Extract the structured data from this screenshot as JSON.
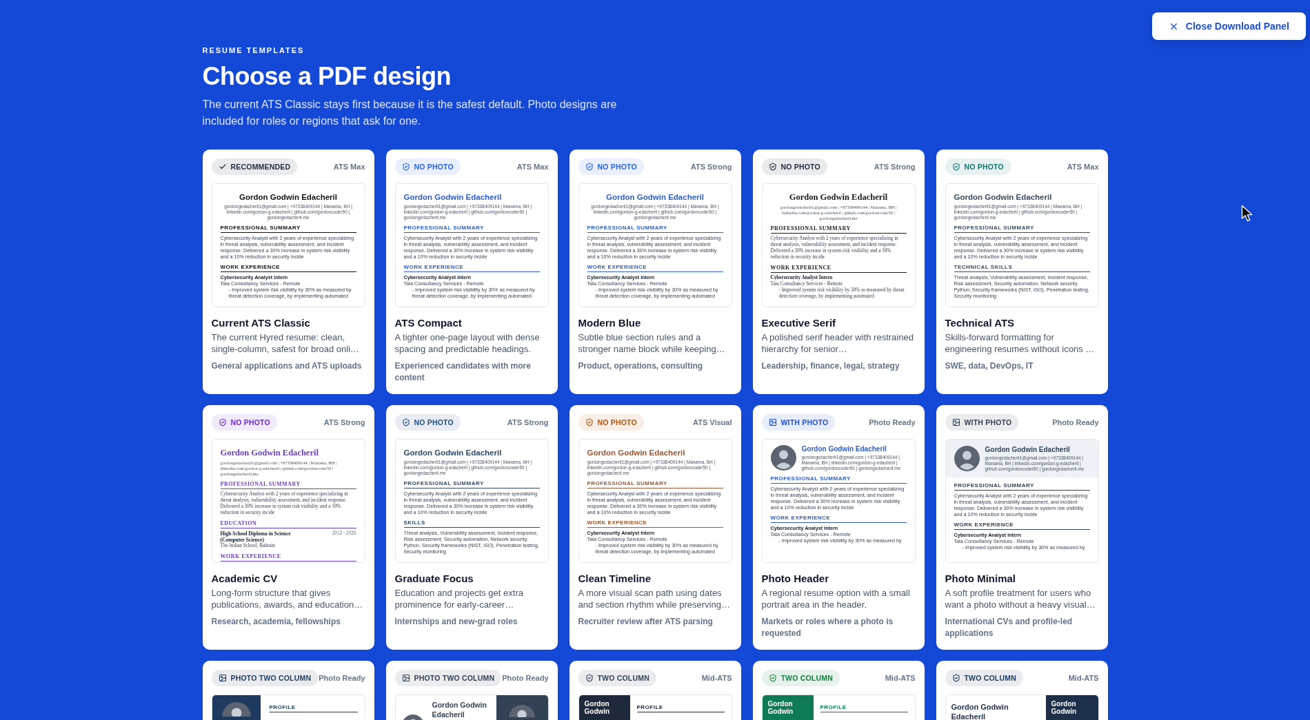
{
  "header": {
    "eyebrow": "RESUME TEMPLATES",
    "title": "Choose a PDF design",
    "description": "The current ATS Classic stays first because it is the safest default. Photo designs are included for roles or regions that ask for one."
  },
  "close_button": {
    "label": "Close Download Panel"
  },
  "templates": [
    {
      "badge": {
        "kind": "recommended",
        "label": "RECOMMENDED",
        "color": "#1e293b"
      },
      "rating": "ATS Max",
      "preview": {
        "kind": "centered",
        "color": "#111111",
        "name": "Gordon Godwin Edacheril",
        "contact": "gordongedacheril1@gmail.com | +97338409144 | Manama, BH | linkedin.com/gordon-g-edacheril | github.com/gordoncoder50 | gordongedacheril.me",
        "sections": [
          {
            "heading": "PROFESSIONAL SUMMARY",
            "kind": "text",
            "text": "Cybersecurity Analyst with 2 years of experience specializing in threat analysis, vulnerability assessment, and incident response. Delivered a 30% increase in system risk visibility and a 10% reduction in security incide"
          },
          {
            "heading": "WORK EXPERIENCE",
            "kind": "job",
            "title": "Cybersecurity Analyst Intern",
            "company": "Tata Consultancy Services - Remote",
            "bullet": "- Improved system risk visibility by 30% as measured by threat detection coverage, by implementing automated"
          }
        ]
      },
      "title": "Current ATS Classic",
      "description": "The current Hyred resume: clean, single-column, safest for broad onli…",
      "audience": "General applications and ATS uploads"
    },
    {
      "badge": {
        "kind": "no-photo",
        "label": "NO PHOTO",
        "color": "#2563eb"
      },
      "rating": "ATS Max",
      "preview": {
        "kind": "left",
        "color": "#2f5bc9",
        "name": "Gordon Godwin Edacheril",
        "contact": "gordongedacheril1@gmail.com | +97338409144 | Manama, BH | linkedin.com/gordon-g-edacheril | github.com/gordoncoder50 | gordongedacheril.me",
        "sections": [
          {
            "heading": "PROFESSIONAL SUMMARY",
            "kind": "text",
            "text": "Cybersecurity Analyst with 2 years of experience specializing in threat analysis, vulnerability assessment, and incident response. Delivered a 30% increase in system risk visibility and a 10% reduction in security incide"
          },
          {
            "heading": "WORK EXPERIENCE",
            "kind": "job",
            "title": "Cybersecurity Analyst Intern",
            "company": "Tata Consultancy Services - Remote",
            "bullet": "- Improved system risk visibility by 30% as measured by threat detection coverage, by implementing automated"
          }
        ]
      },
      "title": "ATS Compact",
      "description": "A tighter one-page layout with dense spacing and predictable headings.",
      "audience": "Experienced candidates with more content"
    },
    {
      "badge": {
        "kind": "no-photo",
        "label": "NO PHOTO",
        "color": "#2563eb"
      },
      "rating": "ATS Strong",
      "preview": {
        "kind": "centered",
        "color": "#2f5fc4",
        "name": "Gordon Godwin Edacheril",
        "contact": "gordongedacheril1@gmail.com | +97338409144 | Manama, BH | linkedin.com/gordon-g-edacheril | github.com/gordoncoder50 | gordongedacheril.me",
        "sections": [
          {
            "heading": "PROFESSIONAL SUMMARY",
            "kind": "text",
            "text": "Cybersecurity Analyst with 2 years of experience specializing in threat analysis, vulnerability assessment, and incident response. Delivered a 30% increase in system risk visibility and a 10% reduction in security incide"
          },
          {
            "heading": "WORK EXPERIENCE",
            "kind": "job",
            "title": "Cybersecurity Analyst Intern",
            "company": "Tata Consultancy Services - Remote",
            "bullet": "- Improved system risk visibility by 30% as measured by threat detection coverage, by implementing automated"
          }
        ]
      },
      "title": "Modern Blue",
      "description": "Subtle blue section rules and a stronger name block while keeping…",
      "audience": "Product, operations, consulting"
    },
    {
      "badge": {
        "kind": "no-photo",
        "label": "NO PHOTO",
        "color": "#1e293b"
      },
      "rating": "ATS Strong",
      "preview": {
        "kind": "serif-centered",
        "color": "#1a1a1a",
        "name": "Gordon Godwin Edacheril",
        "contact": "gordongedacheril1@gmail.com | +97338409144 | Manama, BH | linkedin.com/gordon-g-edacheril | github.com/gordoncoder50 | gordongedacheril.me",
        "sections": [
          {
            "heading": "PROFESSIONAL SUMMARY",
            "kind": "text",
            "text": "Cybersecurity Analyst with 2 years of experience specializing in threat analysis, vulnerability assessment, and incident response. Delivered a 30% increase in system risk visibility and a 10% reduction in security incide"
          },
          {
            "heading": "WORK EXPERIENCE",
            "kind": "job",
            "title": "Cybersecurity Analyst Intern",
            "company": "Tata Consultancy Services - Remote",
            "bullet": "- Improved system risk visibility by 30% as measured by threat detection coverage, by implementing automated"
          }
        ]
      },
      "title": "Executive Serif",
      "description": "A polished serif header with restrained hierarchy for senior…",
      "audience": "Leadership, finance, legal, strategy"
    },
    {
      "badge": {
        "kind": "no-photo",
        "label": "NO PHOTO",
        "color": "#0f766e"
      },
      "rating": "ATS Max",
      "preview": {
        "kind": "left",
        "color": "#3b4a5e",
        "name": "Gordon Godwin Edacheril",
        "contact": "gordongedacheril1@gmail.com | +97338409144 | Manama, BH | linkedin.com/gordon-g-edacheril | github.com/gordoncoder50 | gordongedacheril.me",
        "sections": [
          {
            "heading": "PROFESSIONAL SUMMARY",
            "kind": "text",
            "text": "Cybersecurity Analyst with 2 years of experience specializing in threat analysis, vulnerability assessment, and incident response. Delivered a 30% increase in system risk visibility and a 10% reduction in security incide"
          },
          {
            "heading": "TECHNICAL SKILLS",
            "kind": "text",
            "text": "Threat analysis, Vulnerability assessment, Incident response, Risk assessment, Security automation, Network security, Python, Security frameworks (NIST, ISO), Penetration testing, Security monitoring"
          }
        ]
      },
      "title": "Technical ATS",
      "description": "Skills-forward formatting for engineering resumes without icons …",
      "audience": "SWE, data, DevOps, IT"
    },
    {
      "badge": {
        "kind": "no-photo",
        "label": "NO PHOTO",
        "color": "#6d28d9"
      },
      "rating": "ATS Strong",
      "preview": {
        "kind": "serif-left",
        "color": "#6a3fc1",
        "name": "Gordon Godwin Edacheril",
        "contact": "gordongedacheril1@gmail.com | +97338409144 | Manama, BH | linkedin.com/gordon-g-edacheril | github.com/gordoncoder50 | gordongedacheril.me",
        "sections": [
          {
            "heading": "PROFESSIONAL SUMMARY",
            "kind": "text",
            "text": "Cybersecurity Analyst with 2 years of experience specializing in threat analysis, vulnerability assessment, and incident response. Delivered a 30% increase in system risk visibility and a 10% reduction in security incide"
          },
          {
            "heading": "EDUCATION",
            "kind": "education",
            "title": "High School Diploma in Science (Computer Science)",
            "dates": "2012 - 2026",
            "school": "The Indian School, Bahrain"
          },
          {
            "heading": "WORK EXPERIENCE",
            "kind": "heading"
          }
        ]
      },
      "title": "Academic CV",
      "description": "Long-form structure that gives publications, awards, and education…",
      "audience": "Research, academia, fellowships"
    },
    {
      "badge": {
        "kind": "no-photo",
        "label": "NO PHOTO",
        "color": "#1e4f86"
      },
      "rating": "ATS Strong",
      "preview": {
        "kind": "left",
        "color": "#2d4a6e",
        "name": "Gordon Godwin Edacheril",
        "contact": "gordongedacheril1@gmail.com | +97338409144 | Manama, BH | linkedin.com/gordon-g-edacheril | github.com/gordoncoder50 | gordongedacheril.me",
        "sections": [
          {
            "heading": "PROFESSIONAL SUMMARY",
            "kind": "text",
            "text": "Cybersecurity Analyst with 2 years of experience specializing in threat analysis, vulnerability assessment, and incident response. Delivered a 30% increase in system risk visibility and a 10% reduction in security incide"
          },
          {
            "heading": "SKILLS",
            "kind": "text",
            "text": "Threat analysis, Vulnerability assessment, Incident response, Risk assessment, Security automation, Network security, Python, Security frameworks (NIST, ISO), Penetration testing, Security monitoring"
          }
        ]
      },
      "title": "Graduate Focus",
      "description": "Education and projects get extra prominence for early-career…",
      "audience": "Internships and new-grad roles"
    },
    {
      "badge": {
        "kind": "no-photo",
        "label": "NO PHOTO",
        "color": "#b45309"
      },
      "rating": "ATS Visual",
      "preview": {
        "kind": "left",
        "color": "#9c5630",
        "name": "Gordon Godwin Edacheril",
        "contact": "gordongedacheril1@gmail.com | +97338409144 | Manama, BH | linkedin.com/gordon-g-edacheril | github.com/gordoncoder50 | gordongedacheril.me",
        "sections": [
          {
            "heading": "PROFESSIONAL SUMMARY",
            "kind": "text",
            "text": "Cybersecurity Analyst with 2 years of experience specializing in threat analysis, vulnerability assessment, and incident response. Delivered a 30% increase in system risk visibility and a 10% reduction in security incide"
          },
          {
            "heading": "WORK EXPERIENCE",
            "kind": "job",
            "title": "Cybersecurity Analyst Intern",
            "company": "Tata Consultancy Services - Remote",
            "bullet": "- Improved system risk visibility by 30% as measured by threat detection coverage, by implementing automated"
          }
        ]
      },
      "title": "Clean Timeline",
      "description": "A more visual scan path using dates and section rhythm while preserving…",
      "audience": "Recruiter review after ATS parsing"
    },
    {
      "badge": {
        "kind": "photo",
        "label": "WITH PHOTO",
        "color": "#1d4ed8"
      },
      "rating": "Photo Ready",
      "preview": {
        "kind": "photo-header",
        "color": "#2f5bc9",
        "name": "Gordon Godwin Edacheril",
        "contact": "gordongedacheril1@gmail.com | +97338409144 | Manama, BH | linkedin.com/gordon-g-edacheril | github.com/gordoncoder50 | gordongedacheril.me",
        "sections": [
          {
            "heading": "PROFESSIONAL SUMMARY",
            "kind": "text",
            "text": "Cybersecurity Analyst with 2 years of experience specializing in threat analysis, vulnerability assessment, and incident response. Delivered a 30% increase in system risk visibility and a 10% reduction in security incide"
          },
          {
            "heading": "WORK EXPERIENCE",
            "kind": "job",
            "title": "Cybersecurity Analyst Intern",
            "company": "Tata Consultancy Services - Remote",
            "bullet": "- Improved system risk visibility by 30% as measured by"
          }
        ]
      },
      "title": "Photo Header",
      "description": "A regional resume option with a small portrait area in the header.",
      "audience": "Markets or roles where a photo is requested"
    },
    {
      "badge": {
        "kind": "photo",
        "label": "WITH PHOTO",
        "color": "#334155"
      },
      "rating": "Photo Ready",
      "preview": {
        "kind": "photo-banner",
        "color": "#334155",
        "name": "Gordon Godwin Edacheril",
        "contact": "gordongedacheril1@gmail.com | +97338409144 | Manama, BH | linkedin.com/gordon-g-edacheril | github.com/gordoncoder50 | gordongedacheril.me",
        "sections": [
          {
            "heading": "PROFESSIONAL SUMMARY",
            "kind": "text",
            "text": "Cybersecurity Analyst with 2 years of experience specializing in threat analysis, vulnerability assessment, and incident response. Delivered a 30% increase in system risk visibility and a 10% reduction in security incide"
          },
          {
            "heading": "WORK EXPERIENCE",
            "kind": "job",
            "title": "Cybersecurity Analyst Intern",
            "company": "Tata Consultancy Services - Remote",
            "bullet": "- Improved system risk visibility by 30% as measured by"
          }
        ]
      },
      "title": "Photo Minimal",
      "description": "A soft profile treatment for users who want a photo without a heavy visual…",
      "audience": "International CVs and profile-led applications"
    },
    {
      "badge": {
        "kind": "photo",
        "label": "PHOTO TWO COLUMN",
        "color": "#1e3a5f"
      },
      "rating": "Photo Ready",
      "preview": {
        "kind": "photo-sidebar",
        "color": "#1e3a5f",
        "sections": [
          {
            "heading": "PROFILE",
            "kind": "heading"
          }
        ]
      }
    },
    {
      "badge": {
        "kind": "photo",
        "label": "PHOTO TWO COLUMN",
        "color": "#334155"
      },
      "rating": "Photo Ready",
      "preview": {
        "kind": "photo-split",
        "color": "#334155",
        "name": "Gordon Godwin Edacheril"
      }
    },
    {
      "badge": {
        "kind": "no-photo",
        "label": "TWO COLUMN",
        "color": "#334155"
      },
      "rating": "Mid-ATS",
      "preview": {
        "kind": "name-sidebar",
        "color": "#1e293b",
        "name": "Gordon Godwin",
        "sections": [
          {
            "heading": "PROFILE",
            "kind": "heading"
          }
        ]
      }
    },
    {
      "badge": {
        "kind": "no-photo",
        "label": "TWO COLUMN",
        "color": "#15803d"
      },
      "rating": "Mid-ATS",
      "preview": {
        "kind": "name-sidebar",
        "color": "#0f7b56",
        "name": "Gordon Godwin",
        "sections": [
          {
            "heading": "PROFILE",
            "kind": "heading"
          }
        ]
      }
    },
    {
      "badge": {
        "kind": "no-photo",
        "label": "TWO COLUMN",
        "color": "#1e3a5f"
      },
      "rating": "Mid-ATS",
      "preview": {
        "kind": "name-split",
        "color": "#1e2f4a",
        "name": "Gordon Godwin Edacheril",
        "side_name": "Gordon Godwin"
      }
    }
  ]
}
